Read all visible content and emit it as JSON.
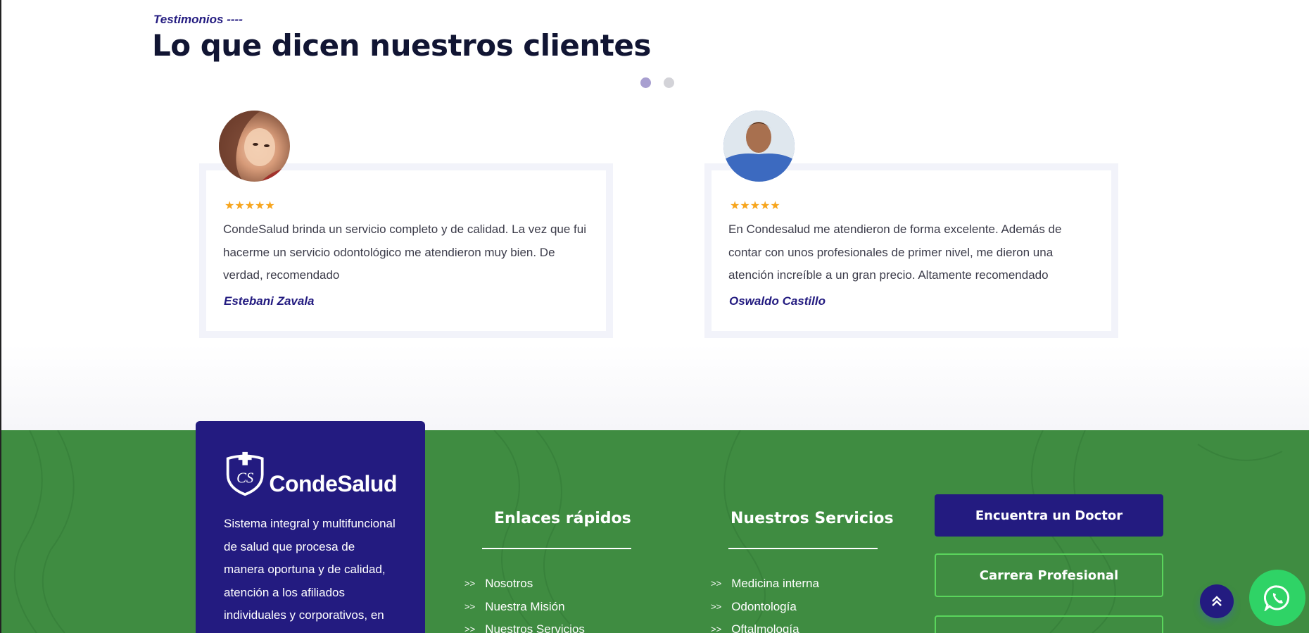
{
  "testimonials": {
    "eyebrow": "Testimonios ----",
    "title": "Lo que dicen nuestros clientes",
    "cards": [
      {
        "stars": "★★★★★",
        "quote": "CondeSalud brinda un servicio completo y de calidad. La vez que fui hacerme un servicio odontológico me atendieron muy bien. De verdad, recomendado",
        "author": "Estebani Zavala"
      },
      {
        "stars": "★★★★★",
        "quote": "En Condesalud me atendieron de forma excelente. Además de contar con unos profesionales de primer nivel, me dieron una atención increíble a un gran precio. Altamente recomendado",
        "author": "Oswaldo Castillo"
      }
    ]
  },
  "footer": {
    "brand_name": "CondeSalud",
    "brand_description": "Sistema integral y multifuncional de salud que procesa de manera oportuna y de calidad, atención a los afiliados individuales y corporativos, en los",
    "quick_links": {
      "title": "Enlaces rápidos",
      "items": [
        "Nosotros",
        "Nuestra Misión",
        "Nuestros Servicios"
      ]
    },
    "services": {
      "title": "Nuestros Servicios",
      "items": [
        "Medicina interna",
        "Odontología",
        "Oftalmología"
      ]
    },
    "buttons": {
      "find_doctor": "Encuentra un Doctor",
      "career": "Carrera Profesional",
      "third": ""
    }
  },
  "icons": {
    "scroll_top": "double-chevron-up-icon",
    "whatsapp": "whatsapp-icon",
    "star": "star-icon"
  },
  "colors": {
    "primary": "#231b80",
    "footer_green": "#3f8c41",
    "star": "#f7a51d",
    "whatsapp": "#2fd366"
  }
}
